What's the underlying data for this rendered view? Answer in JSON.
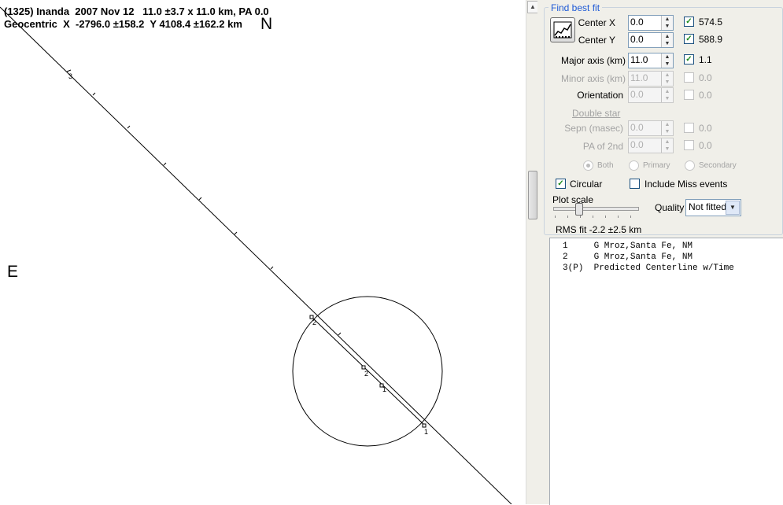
{
  "plot": {
    "title_line1": "(1325) Inanda  2007 Nov 12   11.0 ±3.7 x 11.0 km, PA 0.0",
    "title_line2": "Geocentric  X  -2796.0 ±158.2  Y 4108.4 ±162.2 km",
    "north_label": "N",
    "east_label": "E",
    "chord_labels": [
      "3",
      "2",
      "2",
      "1",
      "1"
    ]
  },
  "panel": {
    "group_title": "Find best fit",
    "center_x": {
      "label": "Center X",
      "value": "0.0",
      "checked": true,
      "result": "574.5"
    },
    "center_y": {
      "label": "Center Y",
      "value": "0.0",
      "checked": true,
      "result": "588.9"
    },
    "major_axis": {
      "label": "Major axis (km)",
      "value": "11.0",
      "checked": true,
      "result": "1.1"
    },
    "minor_axis": {
      "label": "Minor axis (km)",
      "value": "11.0",
      "checked": false,
      "result": "0.0"
    },
    "orientation": {
      "label": "Orientation",
      "value": "0.0",
      "checked": false,
      "result": "0.0"
    },
    "double_star_link": "Double star",
    "sepn": {
      "label": "Sepn (masec)",
      "value": "0.0",
      "checked": false,
      "result": "0.0"
    },
    "pa2": {
      "label": "PA of 2nd",
      "value": "0.0",
      "checked": false,
      "result": "0.0"
    },
    "radio_options": [
      "Both",
      "Primary",
      "Secondary"
    ],
    "radio_selected": "Both",
    "circular": {
      "label": "Circular",
      "checked": true
    },
    "include_miss": {
      "label": "Include Miss events",
      "checked": false
    },
    "plot_scale_label": "Plot scale",
    "quality_label": "Quality",
    "quality_value": "Not fitted",
    "rms_fit": "RMS fit -2.2 ±2.5 km"
  },
  "observers": [
    "1     G Mroz,Santa Fe, NM",
    "2     G Mroz,Santa Fe, NM",
    "3(P)  Predicted Centerline w/Time"
  ],
  "colors": {
    "panel_bg": "#f0efe9",
    "group_title": "#1e5ad6",
    "check_mark": "#1a8a1a"
  }
}
